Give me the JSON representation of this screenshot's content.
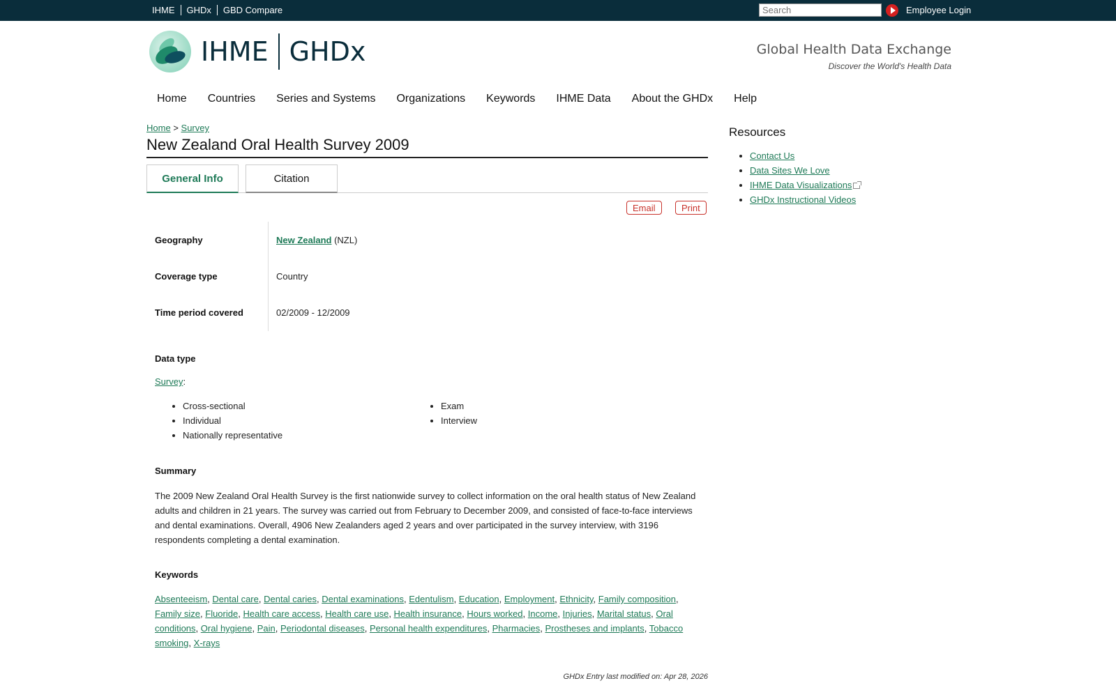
{
  "topbar": {
    "links": [
      "IHME",
      "GHDx",
      "GBD Compare"
    ],
    "search_placeholder": "Search",
    "login": "Employee Login"
  },
  "header": {
    "brand_left": "IHME",
    "brand_right": "GHDx",
    "tagline": "Global Health Data Exchange",
    "subtagline": "Discover the World's Health Data"
  },
  "nav": [
    "Home",
    "Countries",
    "Series and Systems",
    "Organizations",
    "Keywords",
    "IHME Data",
    "About the GHDx",
    "Help"
  ],
  "breadcrumb": {
    "home": "Home",
    "sep": ">",
    "current": "Survey"
  },
  "page_title": "New Zealand Oral Health Survey 2009",
  "tabs": {
    "active": "General Info",
    "other": "Citation"
  },
  "actions": {
    "email": "Email",
    "print": "Print"
  },
  "info": {
    "geography_label": "Geography",
    "geography_link": "New Zealand",
    "geography_code": "(NZL)",
    "coverage_label": "Coverage type",
    "coverage_value": "Country",
    "period_label": "Time period covered",
    "period_value": "02/2009 - 12/2009"
  },
  "data_type": {
    "label": "Data type",
    "link": "Survey",
    "colon": ":",
    "col1": [
      "Cross-sectional",
      "Individual",
      "Nationally representative"
    ],
    "col2": [
      "Exam",
      "Interview"
    ]
  },
  "summary": {
    "label": "Summary",
    "text": "The 2009 New Zealand Oral Health Survey is the first nationwide survey to collect information on the oral health status of New Zealand adults and children in 21 years. The survey was carried out from February to December 2009, and consisted of face-to-face interviews and dental examinations. Overall, 4906 New Zealanders aged 2 years and over participated in the survey interview, with 3196 respondents completing a dental examination."
  },
  "keywords": {
    "label": "Keywords",
    "items": [
      "Absenteeism",
      "Dental care",
      "Dental caries",
      "Dental examinations",
      "Edentulism",
      "Education",
      "Employment",
      "Ethnicity",
      "Family composition",
      "Family size",
      "Fluoride",
      "Health care access",
      "Health care use",
      "Health insurance",
      "Hours worked",
      "Income",
      "Injuries",
      "Marital status",
      "Oral conditions",
      "Oral hygiene",
      "Pain",
      "Periodontal diseases",
      "Personal health expenditures",
      "Pharmacies",
      "Prostheses and implants",
      "Tobacco smoking",
      "X-rays"
    ]
  },
  "modified": "GHDx Entry last modified on: Apr 28, 2026",
  "resources": {
    "title": "Resources",
    "items": [
      "Contact Us",
      "Data Sites We Love",
      "IHME Data Visualizations",
      "GHDx Instructional Videos"
    ]
  },
  "colors": {
    "topbar": "#0a2d3b",
    "link": "#1e7a57",
    "action": "#c8312a"
  }
}
